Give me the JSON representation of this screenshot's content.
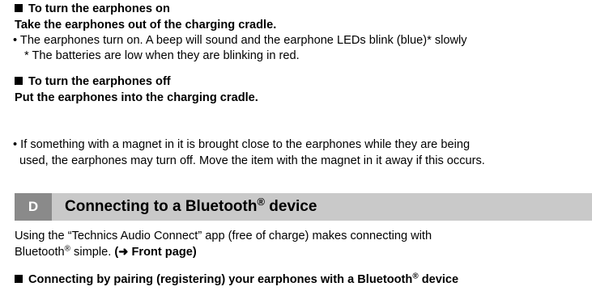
{
  "on_section": {
    "heading": "To turn the earphones on",
    "instruction": "Take the earphones out of the charging cradle.",
    "bullet": "• The earphones turn on. A beep will sound and the earphone LEDs blink (blue)* slowly",
    "footnote": "* The batteries are low when they are blinking in red."
  },
  "off_section": {
    "heading": "To turn the earphones off",
    "instruction": "Put the earphones into the charging cradle."
  },
  "magnet_note": {
    "line1": "• If something with a magnet in it is brought close to the earphones while they are being",
    "line2": "used, the earphones may turn off. Move the item with the magnet in it away if this occurs."
  },
  "banner": {
    "letter": "D",
    "title_pre": "Connecting to a Bluetooth",
    "title_sup": "®",
    "title_post": " device"
  },
  "intro": {
    "line1": "Using the “Technics Audio Connect” app (free of charge) makes connecting with",
    "line2_pre": "Bluetooth",
    "line2_sup": "®",
    "line2_mid": " simple. ",
    "line2_ref": "(➜ Front page)"
  },
  "pairing": {
    "heading_pre": "Connecting by pairing (registering) your earphones with a Bluetooth",
    "heading_sup": "®",
    "heading_post": " device"
  }
}
